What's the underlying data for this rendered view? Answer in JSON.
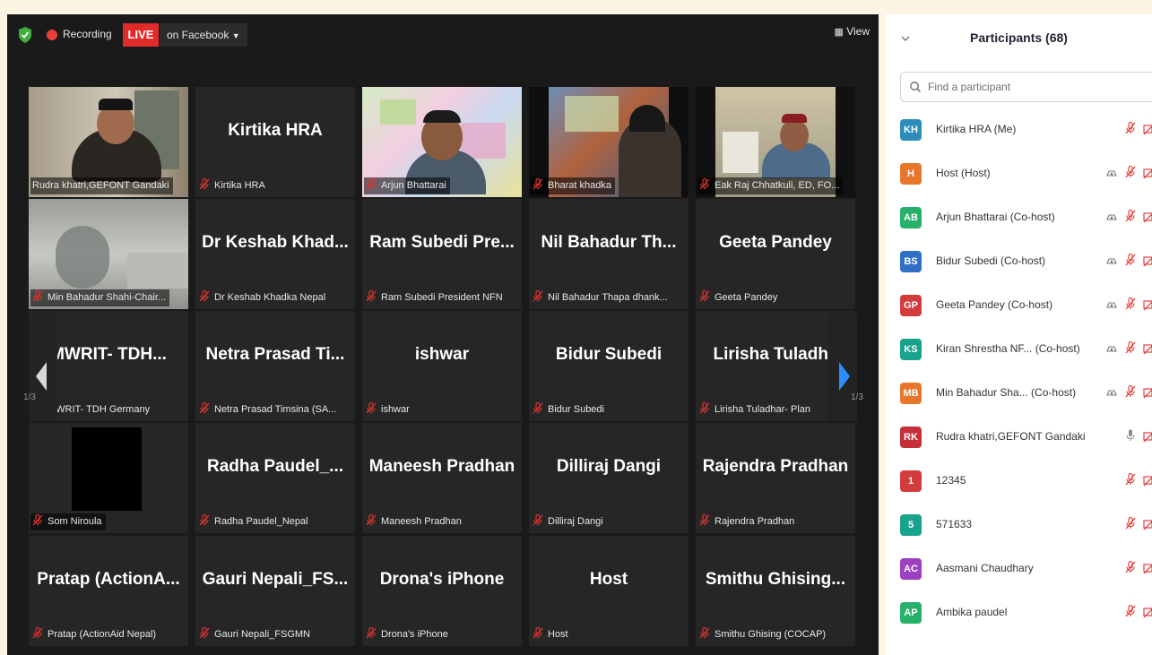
{
  "topbar": {
    "recording": "Recording",
    "live": "LIVE",
    "facebook": "on Facebook",
    "view": "View"
  },
  "gallery": {
    "page_indicator": "1/3",
    "tiles": [
      {
        "display": "",
        "name": "Rudra khatri,GEFONT Gandaki",
        "video": "rudra"
      },
      {
        "display": "Kirtika HRA",
        "name": "Kirtika HRA"
      },
      {
        "display": "",
        "name": "Arjun Bhattarai",
        "video": "arjun"
      },
      {
        "display": "",
        "name": "Bharat khadka",
        "video": "bharat"
      },
      {
        "display": "",
        "name": "Eak Raj Chhatkuli, ED, FO...",
        "video": "eak"
      },
      {
        "display": "",
        "name": "Min Bahadur Shahi-Chair...",
        "video": "min"
      },
      {
        "display": "Dr Keshab Khad...",
        "name": "Dr Keshab Khadka Nepal"
      },
      {
        "display": "Ram Subedi Pre...",
        "name": "Ram Subedi President NFN"
      },
      {
        "display": "Nil Bahadur Th...",
        "name": "Nil Bahadur Thapa dhank..."
      },
      {
        "display": "Geeta Pandey",
        "name": "Geeta Pandey"
      },
      {
        "display": "MWRIT- TDH...",
        "name": "MWRIT- TDH Germany"
      },
      {
        "display": "Netra Prasad Ti...",
        "name": "Netra Prasad Timsina (SA..."
      },
      {
        "display": "ishwar",
        "name": "ishwar"
      },
      {
        "display": "Bidur Subedi",
        "name": "Bidur Subedi"
      },
      {
        "display": "Lirisha Tuladha",
        "name": "Lirisha Tuladhar- Plan"
      },
      {
        "display": "",
        "name": "Som Niroula",
        "video": "som"
      },
      {
        "display": "Radha Paudel_...",
        "name": "Radha Paudel_Nepal"
      },
      {
        "display": "Maneesh Pradhan",
        "name": "Maneesh Pradhan"
      },
      {
        "display": "Dilliraj Dangi",
        "name": "Dilliraj Dangi"
      },
      {
        "display": "Rajendra Pradhan",
        "name": "Rajendra Pradhan"
      },
      {
        "display": "Pratap (ActionA...",
        "name": "Pratap (ActionAid Nepal)"
      },
      {
        "display": "Gauri Nepali_FS...",
        "name": "Gauri Nepali_FSGMN"
      },
      {
        "display": "Drona's iPhone",
        "name": "Drona's iPhone"
      },
      {
        "display": "Host",
        "name": "Host"
      },
      {
        "display": "Smithu Ghising...",
        "name": "Smithu Ghising (COCAP)"
      }
    ]
  },
  "panel": {
    "title": "Participants (68)",
    "search_placeholder": "Find a participant",
    "participants": [
      {
        "initials": "KH",
        "name": "Kirtika HRA (Me)",
        "color": "#2d8cba",
        "cam": false,
        "mic": "muted"
      },
      {
        "initials": "H",
        "name": "Host (Host)",
        "color": "#e8772e",
        "cam": true,
        "mic": "muted"
      },
      {
        "initials": "AB",
        "name": "Arjun Bhattarai (Co-host)",
        "color": "#27b06a",
        "cam": true,
        "mic": "muted"
      },
      {
        "initials": "BS",
        "name": "Bidur Subedi (Co-host)",
        "color": "#2f6fc6",
        "cam": true,
        "mic": "muted"
      },
      {
        "initials": "GP",
        "name": "Geeta Pandey (Co-host)",
        "color": "#d23c3c",
        "cam": true,
        "mic": "muted"
      },
      {
        "initials": "KS",
        "name": "Kiran Shrestha NF... (Co-host)",
        "color": "#1aa38c",
        "cam": true,
        "mic": "muted"
      },
      {
        "initials": "MB",
        "name": "Min Bahadur Sha... (Co-host)",
        "color": "#e8772e",
        "cam": true,
        "mic": "muted"
      },
      {
        "initials": "RK",
        "name": "Rudra khatri,GEFONT Gandaki",
        "color": "#c62f3a",
        "cam": false,
        "mic": "on"
      },
      {
        "initials": "1",
        "name": "12345",
        "color": "#d23c3c",
        "cam": false,
        "mic": "muted"
      },
      {
        "initials": "5",
        "name": "571633",
        "color": "#1aa38c",
        "cam": false,
        "mic": "muted"
      },
      {
        "initials": "AC",
        "name": "Aasmani Chaudhary",
        "color": "#9c3fc1",
        "cam": false,
        "mic": "muted"
      },
      {
        "initials": "AP",
        "name": "Ambika paudel",
        "color": "#27b06a",
        "cam": false,
        "mic": "muted"
      }
    ]
  }
}
